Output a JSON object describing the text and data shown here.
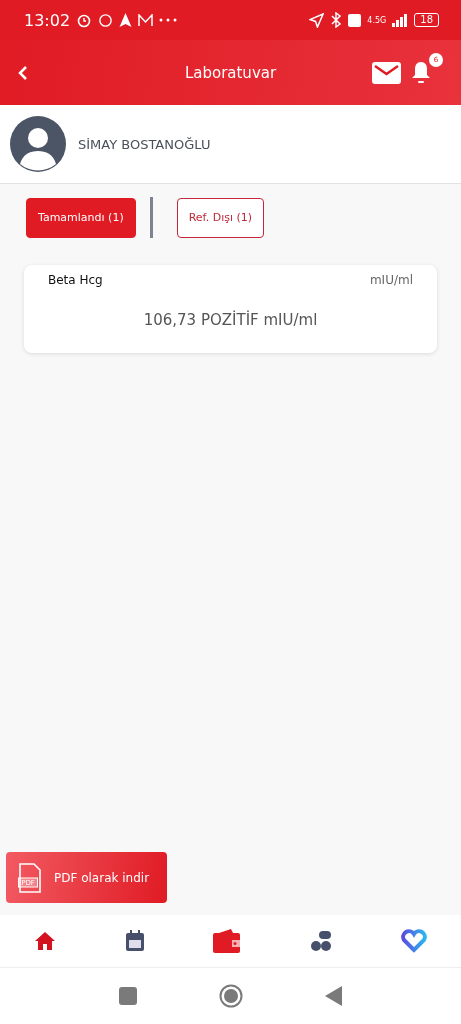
{
  "status_bar": {
    "time": "13:02",
    "network": "4.5G",
    "battery": "18"
  },
  "header": {
    "title": "Laboratuvar",
    "notification_count": "6"
  },
  "patient": {
    "name": "SİMAY BOSTANOĞLU"
  },
  "tabs": [
    {
      "label": "Tamamlandı (1)",
      "selected": true
    },
    {
      "label": "Ref. Dışı (1)",
      "selected": false
    }
  ],
  "results": [
    {
      "test": "Beta Hcg",
      "unit": "mIU/ml",
      "value": "106,73 POZİTİF mIU/ml"
    }
  ],
  "pdf_button": {
    "label": "PDF olarak indir",
    "icon_text": "PDF"
  }
}
